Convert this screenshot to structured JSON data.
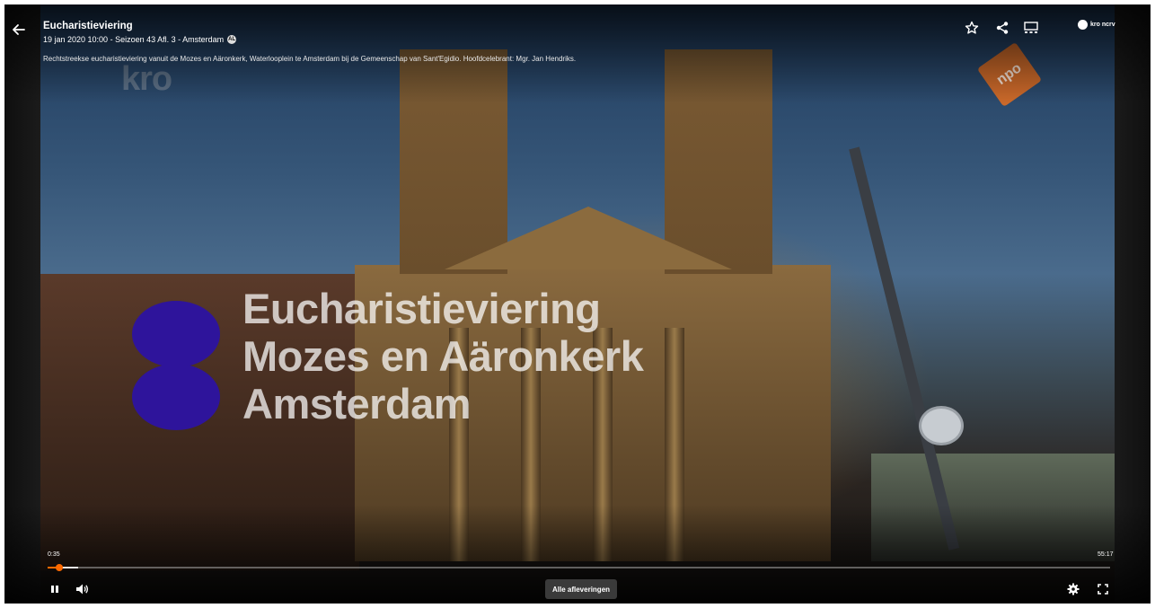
{
  "header": {
    "title": "Eucharistieviering",
    "subtitle": "19 jan 2020 10:00 - Seizoen 43 Afl. 3 - Amsterdam",
    "age_rating": "AL",
    "description": "Rechtstreekse eucharistieviering vanuit de Mozes en Aäronkerk, Waterlooplein te Amsterdam bij de Gemeenschap van Sant'Egidio. Hoofdcelebrant: Mgr. Jan Hendriks."
  },
  "toolbar": {
    "icons": [
      "back-arrow-icon",
      "star-icon",
      "share-icon",
      "chapters-icon",
      "kro-ncrv-logo"
    ],
    "broadcaster_logo": "kro ncrv"
  },
  "video": {
    "overlay_lines": [
      "Eucharistieviering",
      "Mozes en Aäronkerk",
      "Amsterdam"
    ],
    "watermark_left": "kro",
    "watermark_right": "npo"
  },
  "controls": {
    "current_time": "0:35",
    "total_time": "55:17",
    "progress_fraction": 0.0106,
    "buffered_fraction": 0.029,
    "episodes_label": "Alle afleveringen",
    "accent_color": "#ff6a00"
  }
}
